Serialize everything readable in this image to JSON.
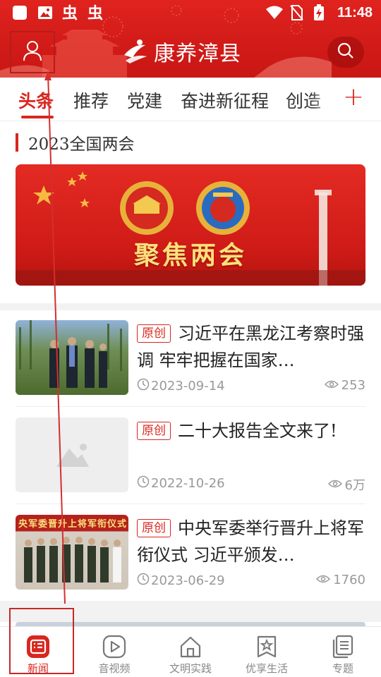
{
  "status_bar": {
    "time": "11:48",
    "left_icons": [
      "app-icon-white-square",
      "gallery-icon",
      "bug-icon",
      "bug-icon"
    ],
    "right_icons": [
      "wifi-icon",
      "no-sim-icon",
      "battery-charging-icon"
    ]
  },
  "header": {
    "title": "康养漳县",
    "left_icon": "user-icon",
    "right_icon": "search-icon",
    "brand_color": "#d8261e"
  },
  "tabs": {
    "items": [
      {
        "label": "头条",
        "active": true
      },
      {
        "label": "推荐",
        "active": false
      },
      {
        "label": "党建",
        "active": false
      },
      {
        "label": "奋进新征程",
        "active": false
      },
      {
        "label": "创造",
        "active": false
      }
    ],
    "add_label": "+"
  },
  "section": {
    "title": "2023全国两会",
    "banner_text": "聚焦两会"
  },
  "news": [
    {
      "tag": "原创",
      "title": "习近平在黑龙江考察时强调 牢牢把握在国家…",
      "date": "2023-09-14",
      "views": "253",
      "thumb": "photo-forest-visit"
    },
    {
      "tag": "原创",
      "title": "二十大报告全文来了!",
      "date": "2022-10-26",
      "views": "6万",
      "thumb": "placeholder-image"
    },
    {
      "tag": "原创",
      "title": "中央军委举行晋升上将军衔仪式 习近平颁发…",
      "date": "2023-06-29",
      "views": "1760",
      "thumb": "photo-ceremony",
      "thumb_caption": "央军委晋升上将军衔仪式"
    }
  ],
  "bottom_nav": {
    "items": [
      {
        "label": "新闻",
        "icon": "news-icon",
        "active": true
      },
      {
        "label": "音视频",
        "icon": "play-icon",
        "active": false
      },
      {
        "label": "文明实践",
        "icon": "home-icon",
        "active": false
      },
      {
        "label": "优享生活",
        "icon": "star-bookmark-icon",
        "active": false
      },
      {
        "label": "专题",
        "icon": "docs-icon",
        "active": false
      }
    ]
  }
}
